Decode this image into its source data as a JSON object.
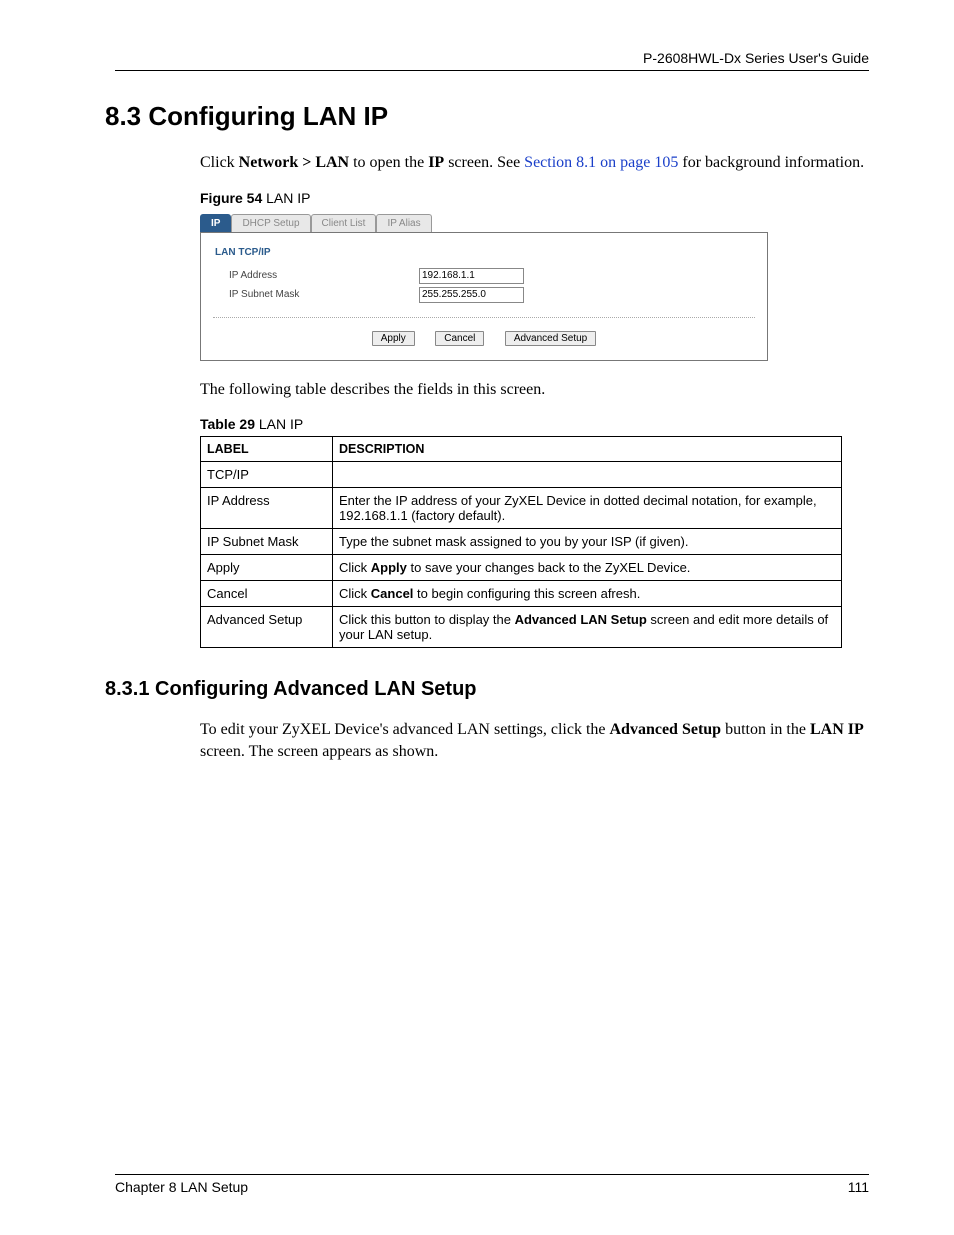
{
  "header": {
    "guide_title": "P-2608HWL-Dx Series User's Guide"
  },
  "section": {
    "h1": "8.3  Configuring LAN IP",
    "intro_pre": "Click ",
    "intro_nav": "Network > LAN",
    "intro_mid1": " to open the ",
    "intro_ip": "IP",
    "intro_mid2": " screen. See ",
    "intro_xref": "Section 8.1 on page 105",
    "intro_post": " for background information.",
    "figure_caption_bold": "Figure 54",
    "figure_caption_rest": "   LAN IP",
    "desc_after_figure": "The following table describes the fields in this screen.",
    "table_caption_bold": "Table 29",
    "table_caption_rest": "   LAN IP",
    "h2": "8.3.1  Configuring Advanced LAN Setup",
    "sub_intro_pre": "To edit your ZyXEL Device's advanced LAN settings, click the ",
    "sub_intro_b1": "Advanced Setup",
    "sub_intro_mid": " button in the ",
    "sub_intro_b2": "LAN IP",
    "sub_intro_post": " screen. The screen appears as shown."
  },
  "figure_ui": {
    "tabs": [
      "IP",
      "DHCP Setup",
      "Client List",
      "IP Alias"
    ],
    "section_title": "LAN TCP/IP",
    "fields": {
      "ip_address_label": "IP Address",
      "ip_address_value": "192.168.1.1",
      "subnet_label": "IP Subnet Mask",
      "subnet_value": "255.255.255.0"
    },
    "buttons": {
      "apply": "Apply",
      "cancel": "Cancel",
      "advanced": "Advanced Setup"
    }
  },
  "table": {
    "head_label": "LABEL",
    "head_desc": "DESCRIPTION",
    "rows": [
      {
        "label": "TCP/IP",
        "desc": ""
      },
      {
        "label": "IP Address",
        "desc": "Enter the IP address of your ZyXEL Device in dotted decimal notation, for example, 192.168.1.1 (factory default)."
      },
      {
        "label": "IP Subnet Mask",
        "desc": "Type the subnet mask assigned to you by your ISP (if given)."
      },
      {
        "label": "Apply",
        "desc_pre": "Click ",
        "desc_b": "Apply",
        "desc_post": " to save your changes back to the ZyXEL Device."
      },
      {
        "label": "Cancel",
        "desc_pre": "Click ",
        "desc_b": "Cancel",
        "desc_post": " to begin configuring this screen afresh."
      },
      {
        "label": "Advanced Setup",
        "desc_pre": "Click this button to display the ",
        "desc_b": "Advanced LAN Setup",
        "desc_post": " screen and edit more details of your LAN setup."
      }
    ]
  },
  "footer": {
    "chapter": "Chapter 8 LAN Setup",
    "page": "111"
  }
}
